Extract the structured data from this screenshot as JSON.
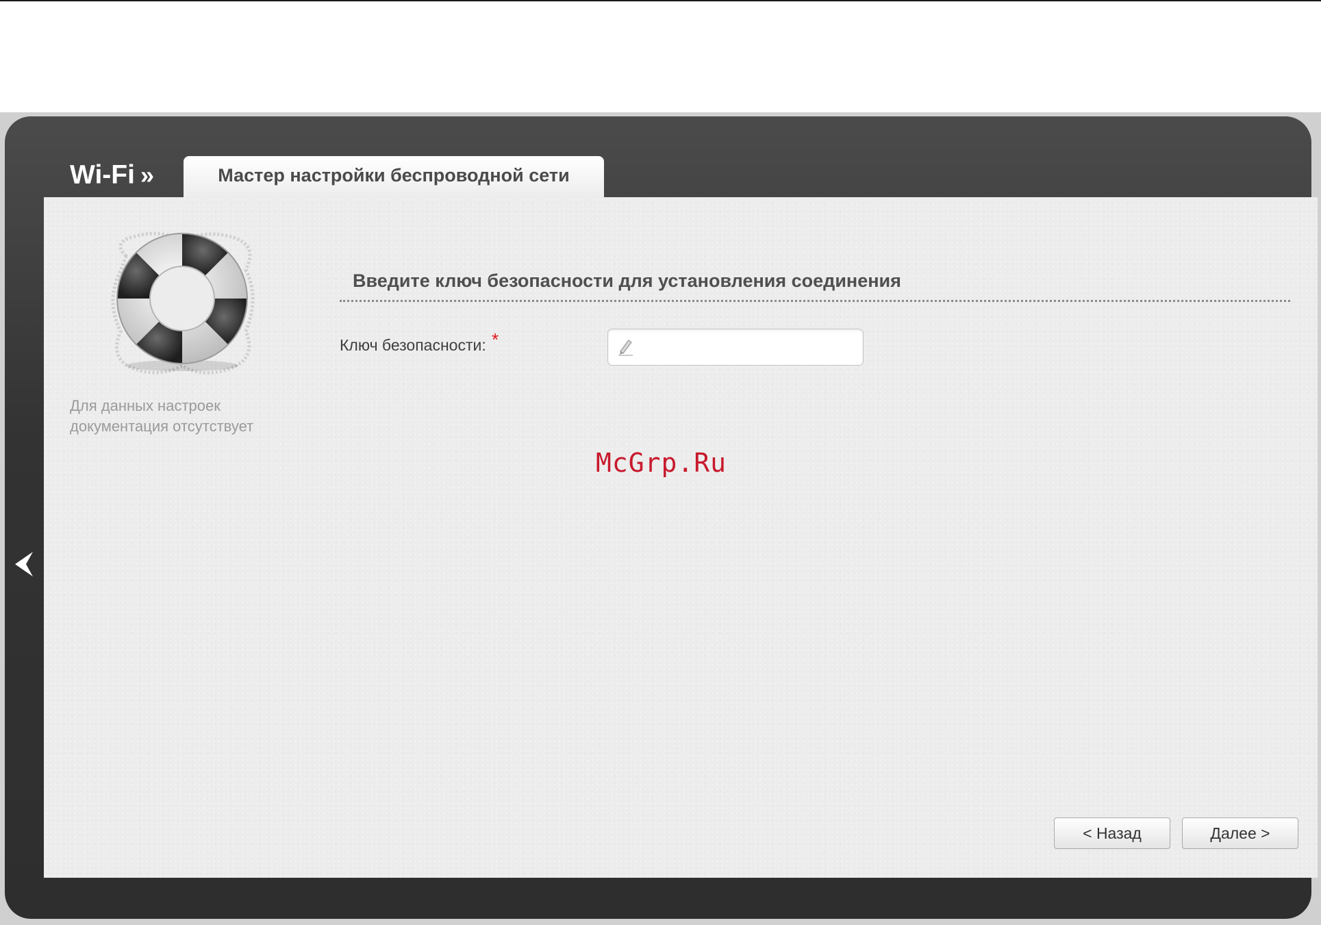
{
  "header": {
    "section_title": "Wi-Fi",
    "section_separator": "»",
    "active_tab": "Мастер настройки беспроводной сети"
  },
  "help": {
    "icon": "lifebuoy-icon",
    "text": "Для данных настроек документация отсутствует"
  },
  "form": {
    "heading": "Введите ключ безопасности для установления соединения",
    "security_key_label": "Ключ безопасности:",
    "required_mark": "*",
    "security_key_value": "",
    "field_icon": "pencil-icon"
  },
  "actions": {
    "back_label": "< Назад",
    "next_label": "Далее >"
  },
  "side_nav": {
    "icon": "chevron-left-icon"
  },
  "watermark": "McGrp.Ru",
  "colors": {
    "shell": "#333333",
    "panel": "#ececec",
    "required": "#e0161b",
    "watermark": "#c8192c"
  }
}
